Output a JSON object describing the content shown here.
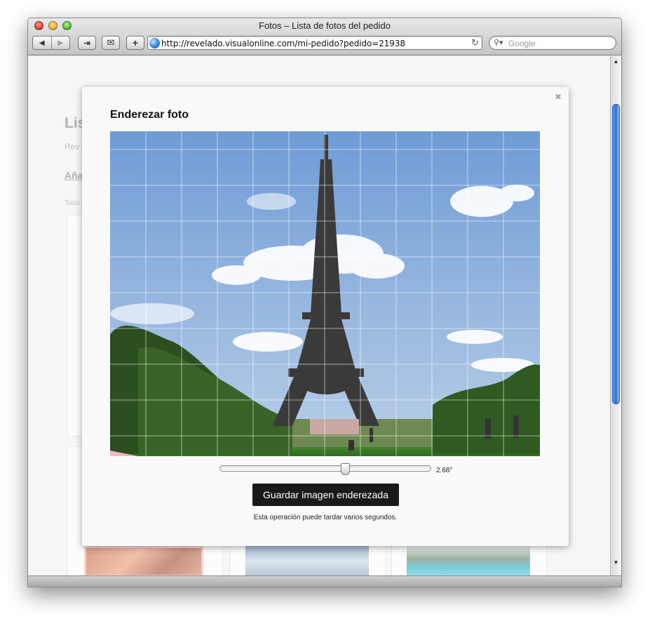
{
  "window": {
    "title": "Fotos – Lista de fotos del pedido"
  },
  "toolbar": {
    "back_icon": "back-arrow",
    "forward_icon": "forward-arrow",
    "url": "http://revelado.visualonline.com/mi-pedido?pedido=21938",
    "search_placeholder": "Google"
  },
  "background_page": {
    "title": "Lis",
    "subtitle": "Rev",
    "link": "Aña",
    "text": "Toda"
  },
  "modal": {
    "title": "Enderezar foto",
    "close": "✖",
    "rotation_value": "2.68°",
    "rotation_slider_fraction": 0.6,
    "save_button": "Guardar imagen enderezada",
    "note": "Esta operación puede tardar varios segundos."
  },
  "colors": {
    "save_button_bg": "#1a1a1a",
    "scroll_thumb": "#2e6fd6"
  }
}
